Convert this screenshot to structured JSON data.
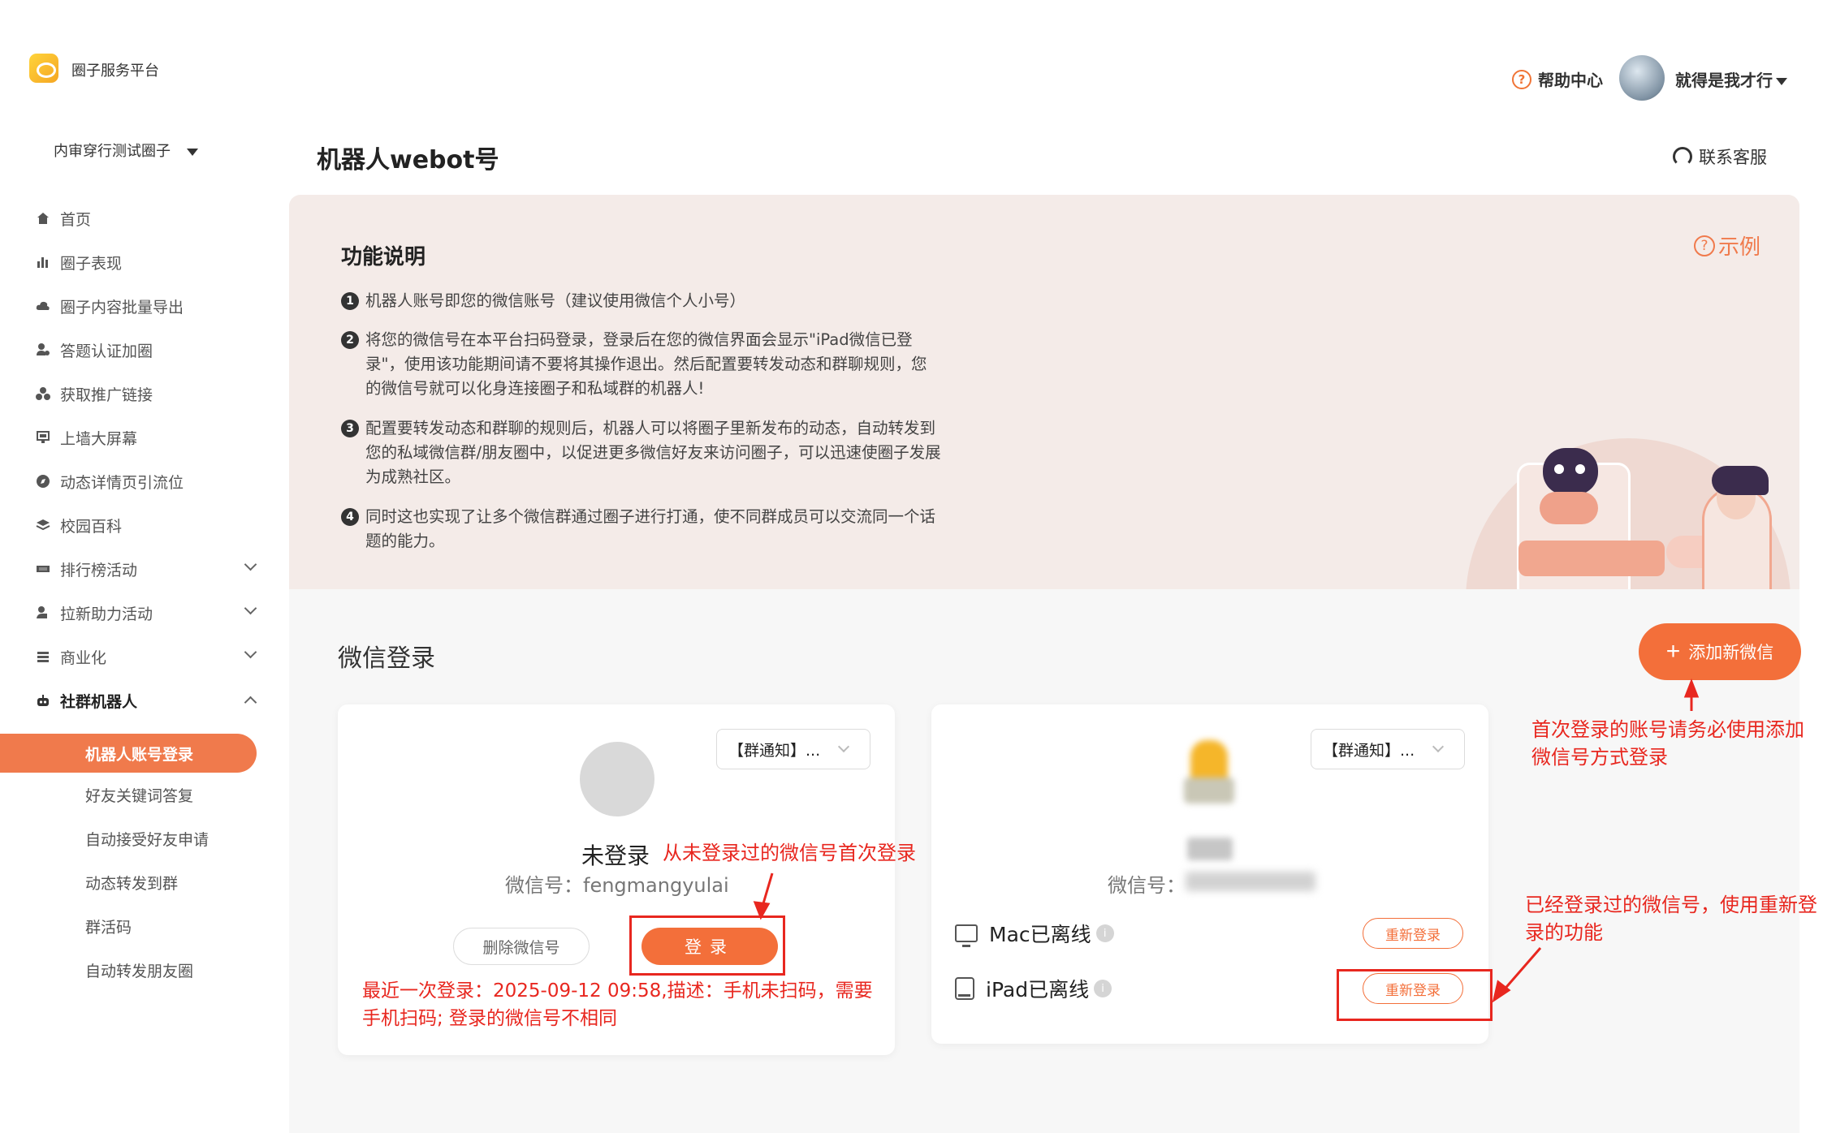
{
  "brand": {
    "name": "圈子服务平台"
  },
  "header": {
    "help_label": "帮助中心",
    "help_icon": "?",
    "username": "就得是我才行"
  },
  "sidebar": {
    "circle_name": "内审穿行测试圈子",
    "items": [
      {
        "label": "首页",
        "icon": "home-icon"
      },
      {
        "label": "圈子表现",
        "icon": "bar-chart-icon"
      },
      {
        "label": "圈子内容批量导出",
        "icon": "cloud-icon"
      },
      {
        "label": "答题认证加圈",
        "icon": "user-check-icon"
      },
      {
        "label": "获取推广链接",
        "icon": "group-icon"
      },
      {
        "label": "上墙大屏幕",
        "icon": "screen-icon"
      },
      {
        "label": "动态详情页引流位",
        "icon": "compass-icon"
      },
      {
        "label": "校园百科",
        "icon": "layers-icon"
      },
      {
        "label": "排行榜活动",
        "icon": "ranking-icon"
      },
      {
        "label": "拉新助力活动",
        "icon": "invite-icon"
      },
      {
        "label": "商业化",
        "icon": "list-icon"
      },
      {
        "label": "社群机器人",
        "icon": "robot-icon"
      }
    ],
    "sub_items": [
      "机器人账号登录",
      "好友关键词答复",
      "自动接受好友申请",
      "动态转发到群",
      "群活码",
      "自动转发朋友圈"
    ]
  },
  "main": {
    "title": "机器人webot号",
    "contact_label": "联系客服",
    "info": {
      "title": "功能说明",
      "example_label": "示例",
      "example_icon": "?",
      "points": [
        {
          "num": "1",
          "text": "机器人账号即您的微信账号（建议使用微信个人小号）"
        },
        {
          "num": "2",
          "text": "将您的微信号在本平台扫码登录，登录后在您的微信界面会显示\"iPad微信已登录\"，使用该功能期间请不要将其操作退出。然后配置要转发动态和群聊规则，您的微信号就可以化身连接圈子和私域群的机器人!"
        },
        {
          "num": "3",
          "text": "配置要转发动态和群聊的规则后，机器人可以将圈子里新发布的动态，自动转发到您的私域微信群/朋友圈中，以促进更多微信好友来访问圈子，可以迅速使圈子发展为成熟社区。"
        },
        {
          "num": "4",
          "text": "同时这也实现了让多个微信群通过圈子进行打通，使不同群成员可以交流同一个话题的能力。"
        }
      ]
    },
    "login": {
      "title": "微信登录",
      "add_label": "添加新微信",
      "card1": {
        "select": "【群通知】...",
        "status": "未登录",
        "wx_id": "微信号：fengmangyulai",
        "delete_label": "删除微信号",
        "login_label": "登录",
        "last_login": "最近一次登录：2025-09-12 09:58,描述：手机未扫码，需要手机扫码; 登录的微信号不相同"
      },
      "card2": {
        "select": "【群通知】...",
        "wx_id_label": "微信号：",
        "devices": [
          {
            "label": "Mac已离线",
            "icon": "monitor-icon",
            "button": "重新登录"
          },
          {
            "label": "iPad已离线",
            "icon": "tablet-icon",
            "button": "重新登录"
          }
        ],
        "info_icon": "i"
      }
    }
  },
  "annotations": {
    "first_login": "从未登录过的微信号首次登录",
    "add_new": "首次登录的账号请务必使用添加微信号方式登录",
    "relogin": "已经登录过的微信号，使用重新登录的功能",
    "color": "#e8271f"
  }
}
